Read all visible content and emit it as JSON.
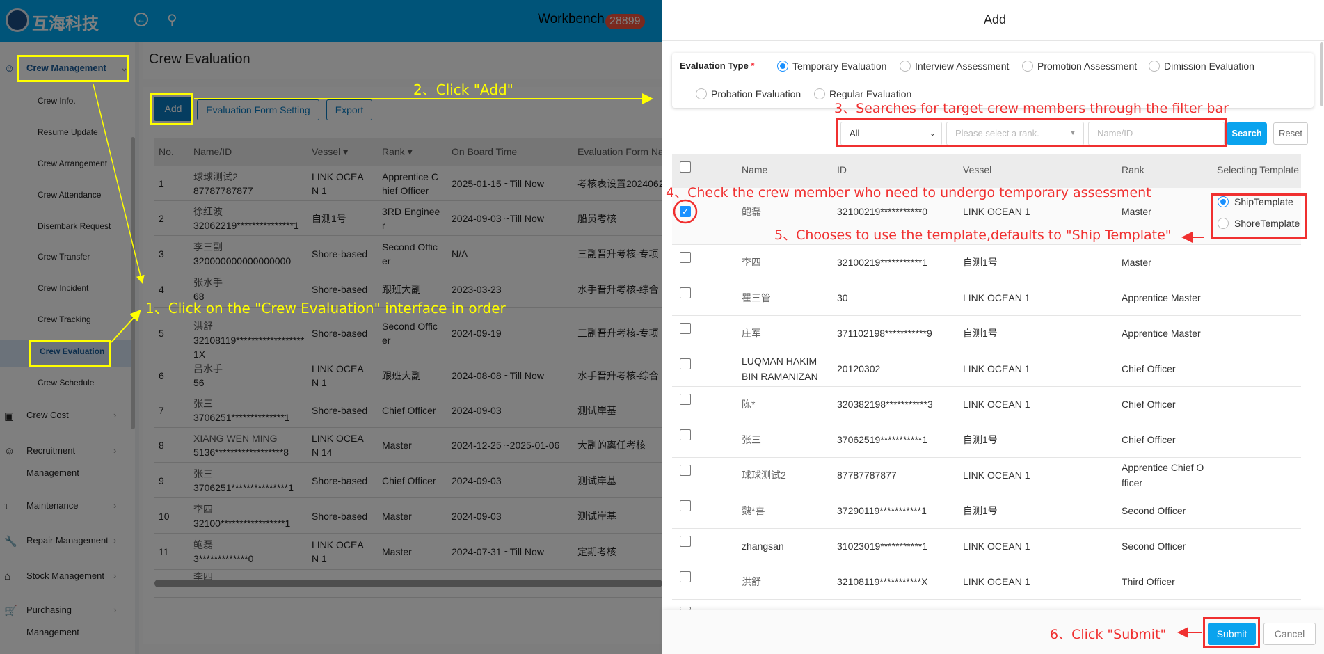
{
  "header": {
    "brand": "互海科技",
    "workbench": "Workbench",
    "badge": "28899",
    "accent": "#00a8f2"
  },
  "sidebar": {
    "crew_management": "Crew Management",
    "sub_items": [
      "Crew Info.",
      "Resume Update",
      "Crew Arrangement",
      "Crew Attendance",
      "Disembark Request",
      "Crew Transfer",
      "Crew Incident",
      "Crew Tracking",
      "Crew Evaluation",
      "Crew Schedule"
    ],
    "modules": [
      {
        "label": "Crew Cost",
        "icon": "wallet-icon"
      },
      {
        "label": "Recruitment",
        "label2": "Management",
        "icon": "user-add-icon"
      },
      {
        "label": "Maintenance",
        "icon": "hammer-icon"
      },
      {
        "label": "Repair Management",
        "icon": "wrench-icon"
      },
      {
        "label": "Stock Management",
        "icon": "home-icon"
      },
      {
        "label": "Purchasing",
        "label2": "Management",
        "icon": "cart-icon"
      }
    ],
    "selected": "Crew Evaluation"
  },
  "page": {
    "title": "Crew Evaluation",
    "buttons": {
      "add": "Add",
      "form_setting": "Evaluation Form Setting",
      "export": "Export"
    },
    "columns": [
      "No.",
      "Name/ID",
      "Vessel",
      "Rank",
      "On Board Time",
      "Evaluation Form Na"
    ],
    "rows": [
      {
        "no": "1",
        "name": "球球测试2",
        "id": "87787787877",
        "vessel": "LINK OCEA\nN 1",
        "rank": "Apprentice C\nhief Officer",
        "time": "2025-01-15 ~Till Now",
        "form": "考核表设置2024062"
      },
      {
        "no": "2",
        "name": "徐红波",
        "id": "32062219***************1",
        "vessel": "自测1号",
        "rank": "3RD Enginee\nr",
        "time": "2024-09-03 ~Till Now",
        "form": "船员考核"
      },
      {
        "no": "3",
        "name": "李三副",
        "id": "320000000000000000",
        "vessel": "Shore-based",
        "rank": "Second Offic\ner",
        "time": "N/A",
        "form": "三副晋升考核-专项"
      },
      {
        "no": "4",
        "name": "张水手",
        "id": "68",
        "vessel": "Shore-based",
        "rank": "跟班大副",
        "time": "2023-03-23",
        "form": "水手晋升考核-综合"
      },
      {
        "no": "5",
        "name": "洪舒",
        "id": "32108119******************\n1X",
        "vessel": "Shore-based",
        "rank": "Second Offic\ner",
        "time": "2024-09-19",
        "form": "三副晋升考核-专项"
      },
      {
        "no": "6",
        "name": "吕水手",
        "id": "56",
        "vessel": "LINK OCEA\nN 1",
        "rank": "跟班大副",
        "time": "2024-08-08 ~Till Now",
        "form": "水手晋升考核-综合"
      },
      {
        "no": "7",
        "name": "张三",
        "id": "3706251**************1",
        "vessel": "Shore-based",
        "rank": "Chief Officer",
        "time": "2024-09-03",
        "form": "测试岸基"
      },
      {
        "no": "8",
        "name": "XIANG WEN MING",
        "id": "5136******************8",
        "vessel": "LINK OCEA\nN 14",
        "rank": "Master",
        "time": "2024-12-25 ~2025-01-06",
        "form": "大副的离任考核"
      },
      {
        "no": "9",
        "name": "张三",
        "id": "3706251***************1",
        "vessel": "Shore-based",
        "rank": "Chief Officer",
        "time": "2024-09-03",
        "form": "测试岸基"
      },
      {
        "no": "10",
        "name": "李四",
        "id": "32100*****************1",
        "vessel": "Shore-based",
        "rank": "Master",
        "time": "2024-09-03",
        "form": "测试岸基"
      },
      {
        "no": "11",
        "name": "鲍磊",
        "id": "3*************0",
        "vessel": "LINK OCEA\nN 1",
        "rank": "Master",
        "time": "2024-07-31 ~Till Now",
        "form": "定期考核"
      },
      {
        "no": "",
        "name": "李四",
        "id": "",
        "vessel": "",
        "rank": "",
        "time": "",
        "form": ""
      }
    ]
  },
  "dialog": {
    "title": "Add",
    "eval_type_label": "Evaluation Type",
    "required_mark": "*",
    "eval_types": [
      {
        "label": "Temporary Evaluation",
        "selected": true
      },
      {
        "label": "Interview Assessment",
        "selected": false
      },
      {
        "label": "Promotion Assessment",
        "selected": false
      },
      {
        "label": "Dimission Evaluation",
        "selected": false
      },
      {
        "label": "Probation Evaluation",
        "selected": false
      },
      {
        "label": "Regular Evaluation",
        "selected": false
      }
    ],
    "filter": {
      "vessel_value": "All",
      "rank_placeholder": "Please select a rank.",
      "name_placeholder": "Name/ID",
      "search": "Search",
      "reset": "Reset"
    },
    "columns": [
      "Name",
      "ID",
      "Vessel",
      "Rank",
      "Selecting Template"
    ],
    "template_options": [
      {
        "label": "ShipTemplate",
        "selected": true
      },
      {
        "label": "ShoreTemplate",
        "selected": false
      }
    ],
    "rows": [
      {
        "name": "鲍磊",
        "id": "32100219***********0",
        "vessel": "LINK OCEAN 1",
        "rank": "Master",
        "checked": true
      },
      {
        "name": "李四",
        "id": "32100219***********1",
        "vessel": "自测1号",
        "rank": "Master",
        "checked": false
      },
      {
        "name": "瞿三管",
        "id": "30",
        "vessel": "LINK OCEAN 1",
        "rank": "Apprentice Master",
        "checked": false
      },
      {
        "name": "庄军",
        "id": "371102198***********9",
        "vessel": "自测1号",
        "rank": "Apprentice Master",
        "checked": false
      },
      {
        "name": "LUQMAN HAKIM\nBIN RAMANIZAN",
        "id": "20120302",
        "vessel": "LINK OCEAN 1",
        "rank": "Chief Officer",
        "checked": false
      },
      {
        "name": "陈*",
        "id": "320382198***********3",
        "vessel": "LINK OCEAN 1",
        "rank": "Chief Officer",
        "checked": false
      },
      {
        "name": "张三",
        "id": "37062519***********1",
        "vessel": "自测1号",
        "rank": "Chief Officer",
        "checked": false
      },
      {
        "name": "球球测试2",
        "id": "87787787877",
        "vessel": "LINK OCEAN 1",
        "rank": "Apprentice Chief O\nfficer",
        "checked": false
      },
      {
        "name": "魏*喜",
        "id": "37290119***********1",
        "vessel": "自测1号",
        "rank": "Second Officer",
        "checked": false
      },
      {
        "name": "zhangsan",
        "id": "31023019***********1",
        "vessel": "LINK OCEAN 1",
        "rank": "Second Officer",
        "checked": false
      },
      {
        "name": "洪舒",
        "id": "32108119***********X",
        "vessel": "LINK OCEAN 1",
        "rank": "Third Officer",
        "checked": false
      }
    ],
    "submit": "Submit",
    "cancel": "Cancel",
    "primary_color": "#0aa3ee"
  },
  "annotations": {
    "step1": "1、Click on the \"Crew Evaluation\" interface in order",
    "step2": "2、Click \"Add\"",
    "step3": "3、Searches for target crew members through the filter bar",
    "step4": "4、Check the crew member who need to undergo temporary assessment",
    "step5": "5、Chooses to use the template,defaults to \"Ship Template\"",
    "step6": "6、Click \"Submit\"",
    "yellow": "#ffff00",
    "red": "#f03030"
  }
}
